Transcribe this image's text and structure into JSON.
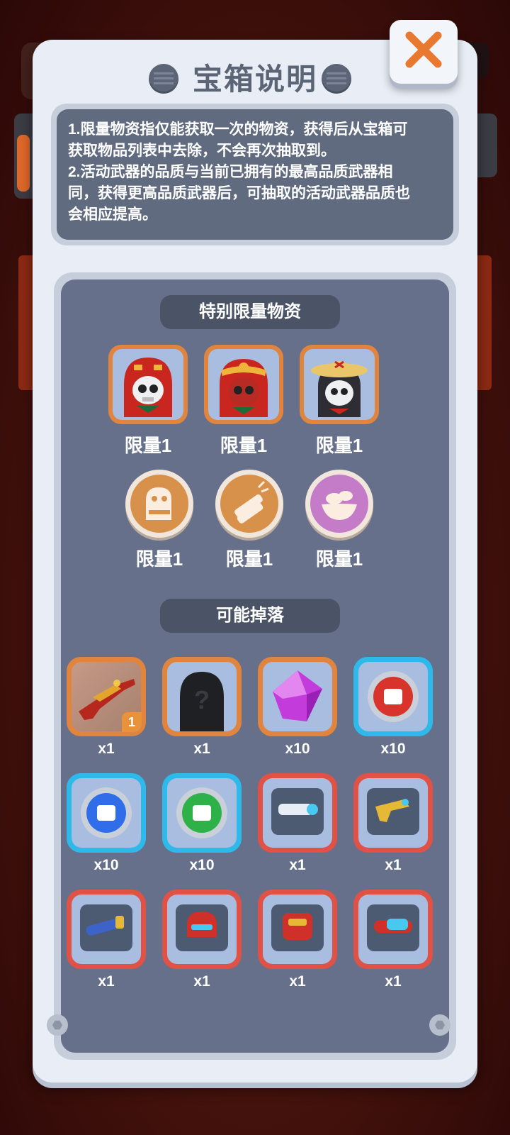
{
  "dialog": {
    "title": "宝箱说明",
    "close_label": "×"
  },
  "description": {
    "lines": [
      "1.限量物资指仅能获取一次的物资，获得后从宝箱可",
      "获取物品列表中去除，不会再次抽取到。",
      "2.活动武器的品质与当前已拥有的最高品质武器相",
      "同，获得更高品质武器后，可抽取的活动武器品质也",
      "会相应提高。"
    ]
  },
  "special_limited": {
    "title": "特别限量物资",
    "items": [
      {
        "icon": "red-hood-skull-avatar",
        "label": "限量1"
      },
      {
        "icon": "monkey-king-skull-avatar",
        "label": "限量1"
      },
      {
        "icon": "straw-hat-skull-avatar",
        "label": "限量1"
      },
      {
        "icon": "stone-lion-emblem",
        "label": "限量1"
      },
      {
        "icon": "firecracker-emblem",
        "label": "限量1"
      },
      {
        "icon": "gold-ingot-bowl-emblem",
        "label": "限量1"
      }
    ]
  },
  "possible_drops": {
    "title": "可能掉落",
    "items": [
      {
        "icon": "dragon-rifle-icon",
        "qty": "x1",
        "badge": "1",
        "frame": "orange"
      },
      {
        "icon": "mystery-character-icon",
        "qty": "x1",
        "frame": "orange"
      },
      {
        "icon": "purple-gem-icon",
        "qty": "x10",
        "frame": "orange"
      },
      {
        "icon": "red-fist-coin-icon",
        "qty": "x10",
        "frame": "blue"
      },
      {
        "icon": "blue-fist-coin-icon",
        "qty": "x10",
        "frame": "blue"
      },
      {
        "icon": "green-fist-coin-icon",
        "qty": "x10",
        "frame": "blue"
      },
      {
        "icon": "blaster-cannon-icon",
        "qty": "x1",
        "frame": "red"
      },
      {
        "icon": "golden-pistol-icon",
        "qty": "x1",
        "frame": "red"
      },
      {
        "icon": "rocket-launcher-icon",
        "qty": "x1",
        "frame": "red"
      },
      {
        "icon": "red-helmet-icon",
        "qty": "x1",
        "frame": "red"
      },
      {
        "icon": "red-armor-icon",
        "qty": "x1",
        "frame": "red"
      },
      {
        "icon": "goggles-icon",
        "qty": "x1",
        "frame": "red"
      }
    ]
  },
  "colors": {
    "frame_orange": "#e0843e",
    "frame_blue": "#2db9ea",
    "frame_red": "#e05146",
    "panel": "#e9eef6",
    "slate": "#66708a"
  }
}
